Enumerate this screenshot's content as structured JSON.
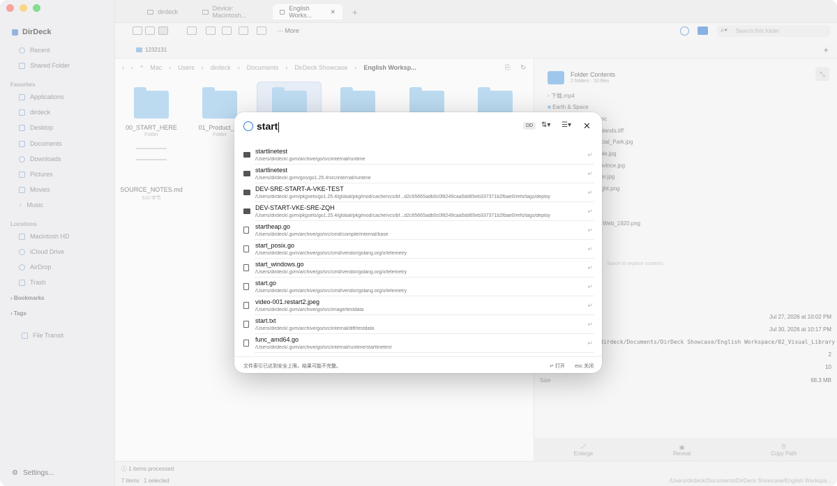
{
  "app": {
    "name": "DirDeck"
  },
  "sidebar": {
    "items": [
      {
        "label": "Recent",
        "icon": "clock-icon"
      },
      {
        "label": "Shared Folder",
        "icon": "shared-folder-icon"
      }
    ],
    "favorites_header": "Favorites",
    "favorites": [
      {
        "label": "Applications",
        "icon": "applications-icon"
      },
      {
        "label": "dirdeck",
        "icon": "home-icon"
      },
      {
        "label": "Desktop",
        "icon": "desktop-icon"
      },
      {
        "label": "Documents",
        "icon": "document-icon"
      },
      {
        "label": "Downloads",
        "icon": "download-icon"
      },
      {
        "label": "Pictures",
        "icon": "pictures-icon"
      },
      {
        "label": "Movies",
        "icon": "movies-icon"
      },
      {
        "label": "Music",
        "icon": "music-icon"
      }
    ],
    "locations_header": "Locations",
    "locations": [
      {
        "label": "Macintosh HD",
        "icon": "disk-icon"
      },
      {
        "label": "iCloud Drive",
        "icon": "cloud-icon"
      },
      {
        "label": "AirDrop",
        "icon": "airdrop-icon"
      },
      {
        "label": "Trash",
        "icon": "trash-icon"
      }
    ],
    "bookmarks": "Bookmarks",
    "tags": "Tags",
    "file_transit": "File Transit",
    "settings": "Settings..."
  },
  "tabs": [
    {
      "label": "dirdeck"
    },
    {
      "label": "Device: Macintosh..."
    },
    {
      "label": "English Works..."
    }
  ],
  "toolbar": {
    "more": "More",
    "search_placeholder": "Search this folder"
  },
  "pathbar": {
    "label": "1232131"
  },
  "breadcrumbs": [
    "Mac",
    "Users",
    "dirdeck",
    "Documents",
    "DirDeck Showcase",
    "English Worksp..."
  ],
  "files": [
    {
      "name": "00_START_HERE",
      "kind": "Folder"
    },
    {
      "name": "01_Product_La",
      "kind": "Folder"
    },
    {
      "name": "SOURCE_NOTES.md",
      "kind": "510 字节"
    }
  ],
  "info": {
    "title": "Folder Contents",
    "subtitle": "2 folders · 10 files",
    "entries": [
      "下载.mp4",
      "Earth & Space",
      "eic",
      "plands.tiff",
      "icial_Park.jpg",
      "ple.jpg",
      "ovince.jpg",
      "ier.jpg",
      "ight.png",
      "Web_1920.png"
    ],
    "hint": "Space to explore contents",
    "date1": "Jul 27, 2026 at 10:02 PM",
    "date2": "Jul 30, 2026 at 10:17 PM",
    "path": "dirdeck/Documents/DirDeck Showcase/English Workspace/02_Visual_Library",
    "v1": "2",
    "v2": "10",
    "size_label": "Size",
    "size": "68.3 MB"
  },
  "bottom_actions": [
    "Enlarge",
    "Reveal",
    "Copy Path"
  ],
  "status": {
    "processed": "1 items processed",
    "items": "7 items",
    "selected": "1 selected",
    "path": "/Users/dirdeck/Documents/DirDeck Showcase/English Workspa..."
  },
  "search": {
    "query": "start",
    "badge": "DD",
    "results": [
      {
        "name": "startlinetest",
        "path": "/Users/dirdeck/.gvm/archive/go/src/internal/runtime",
        "type": "folder"
      },
      {
        "name": "startlinetest",
        "path": "/Users/dirdeck/.gvm/gos/go1.25.4/src/internal/runtime",
        "type": "folder"
      },
      {
        "name": "DEV-SRE-START-A-VKE-TEST",
        "path": "/Users/dirdeck/.gvm/pkgsets/go1.25.4/global/pkg/mod/cache/vcs/bf...d2c65665adb0c0f8249caa5dd65eb337371b2fbae0/refs/tags/deploy",
        "type": "folder"
      },
      {
        "name": "DEV-START-VKE-SRE-ZQH",
        "path": "/Users/dirdeck/.gvm/pkgsets/go1.25.4/global/pkg/mod/cache/vcs/bf...d2c65665adb0c0f8249caa5dd65eb337371b2fbae0/refs/tags/deploy",
        "type": "folder"
      },
      {
        "name": "startheap.go",
        "path": "/Users/dirdeck/.gvm/archive/go/src/cmd/compile/internal/base",
        "type": "file"
      },
      {
        "name": "start_posix.go",
        "path": "/Users/dirdeck/.gvm/archive/go/src/cmd/vendor/golang.org/x/telemetry",
        "type": "file"
      },
      {
        "name": "start_windows.go",
        "path": "/Users/dirdeck/.gvm/archive/go/src/cmd/vendor/golang.org/x/telemetry",
        "type": "file"
      },
      {
        "name": "start.go",
        "path": "/Users/dirdeck/.gvm/archive/go/src/cmd/vendor/golang.org/x/telemetry",
        "type": "file"
      },
      {
        "name": "video-001.restart2.jpeg",
        "path": "/Users/dirdeck/.gvm/archive/go/src/image/testdata",
        "type": "file"
      },
      {
        "name": "start.txt",
        "path": "/Users/dirdeck/.gvm/archive/go/src/internal/diff/testdata",
        "type": "file"
      },
      {
        "name": "func_amd64.go",
        "path": "/Users/dirdeck/.gvm/archive/go/src/internal/runtime/startlinetest",
        "type": "file"
      }
    ],
    "footer_note": "文件索引已达到安全上限，结果可能不完整。",
    "footer_open": "↵ 打开",
    "footer_close": "esc 关闭"
  },
  "colors": {
    "accent": "#2f7bd8",
    "folder": "#8fc6ee"
  }
}
